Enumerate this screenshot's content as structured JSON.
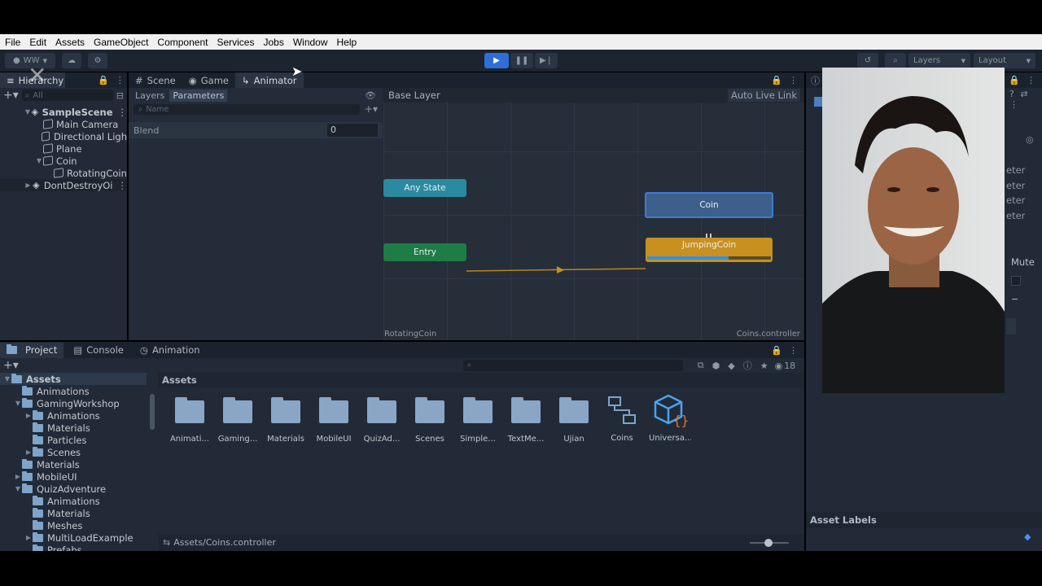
{
  "menu": [
    "File",
    "Edit",
    "Assets",
    "GameObject",
    "Component",
    "Services",
    "Jobs",
    "Window",
    "Help"
  ],
  "toolbar": {
    "account": "WW",
    "layers": "Layers",
    "layout": "Layout"
  },
  "hierarchy": {
    "tab": "Hierarchy",
    "search_placeholder": "All",
    "items": [
      {
        "label": "SampleScene",
        "level": 0,
        "kind": "unity-icon",
        "expanded": true
      },
      {
        "label": "Main Camera",
        "level": 1,
        "kind": "cube-icon"
      },
      {
        "label": "Directional Ligh",
        "level": 1,
        "kind": "cube-icon"
      },
      {
        "label": "Plane",
        "level": 1,
        "kind": "cube-icon"
      },
      {
        "label": "Coin",
        "level": 1,
        "kind": "cube-icon",
        "expanded": true
      },
      {
        "label": "RotatingCoin",
        "level": 2,
        "kind": "cube-icon"
      },
      {
        "label": "DontDestroyOi",
        "level": 0,
        "kind": "unity-icon",
        "expanded": false
      }
    ]
  },
  "center_tabs": [
    "Scene",
    "Game",
    "Animator"
  ],
  "animator": {
    "layers_tab": "Layers",
    "parameters_tab": "Parameters",
    "name_placeholder": "Name",
    "param_name": "Blend",
    "param_value": "0",
    "breadcrumb": "Base Layer",
    "auto_live_link": "Auto Live Link",
    "nodes": {
      "any_state": "Any State",
      "entry": "Entry",
      "coin": "Coin",
      "jumping_coin": "JumpingCoin"
    },
    "jumping_progress": 0.66,
    "footer_left": "RotatingCoin",
    "footer_right": "Coins.controller"
  },
  "bottom_tabs": [
    "Project",
    "Console",
    "Animation"
  ],
  "project": {
    "count": "18",
    "tree": [
      {
        "label": "Assets",
        "level": 0,
        "expanded": true,
        "selected": true
      },
      {
        "label": "Animations",
        "level": 1
      },
      {
        "label": "GamingWorkshop",
        "level": 1,
        "expanded": true
      },
      {
        "label": "Animations",
        "level": 2,
        "collapsed": true
      },
      {
        "label": "Materials",
        "level": 2
      },
      {
        "label": "Particles",
        "level": 2
      },
      {
        "label": "Scenes",
        "level": 2,
        "collapsed": true
      },
      {
        "label": "Materials",
        "level": 1
      },
      {
        "label": "MobileUI",
        "level": 1,
        "collapsed": true
      },
      {
        "label": "QuizAdventure",
        "level": 1,
        "expanded": true
      },
      {
        "label": "Animations",
        "level": 2
      },
      {
        "label": "Materials",
        "level": 2
      },
      {
        "label": "Meshes",
        "level": 2
      },
      {
        "label": "MultiLoadExample",
        "level": 2,
        "collapsed": true
      },
      {
        "label": "Prefabs",
        "level": 2
      }
    ],
    "breadcrumb": "Assets",
    "assets": [
      {
        "label": "Animati...",
        "type": "folder"
      },
      {
        "label": "Gaming...",
        "type": "folder"
      },
      {
        "label": "Materials",
        "type": "folder"
      },
      {
        "label": "MobileUI",
        "type": "folder"
      },
      {
        "label": "QuizAd...",
        "type": "folder"
      },
      {
        "label": "Scenes",
        "type": "folder"
      },
      {
        "label": "Simple...",
        "type": "folder"
      },
      {
        "label": "TextMe...",
        "type": "folder"
      },
      {
        "label": "Ujian",
        "type": "folder"
      },
      {
        "label": "Coins",
        "type": "animator-controller"
      },
      {
        "label": "Universa...",
        "type": "package"
      }
    ],
    "status_path": "Assets/Coins.controller"
  },
  "inspector": {
    "partial_labels": [
      "eter",
      "eter",
      "eter",
      "eter"
    ],
    "mute": "Mute",
    "asset_labels": "Asset Labels"
  },
  "colors": {
    "accent": "#2d6fd6",
    "entry_node": "#1e7c45",
    "any_state_node": "#2a8aa0",
    "default_state": "#c8901e",
    "selected_state": "#3d5f8c"
  }
}
